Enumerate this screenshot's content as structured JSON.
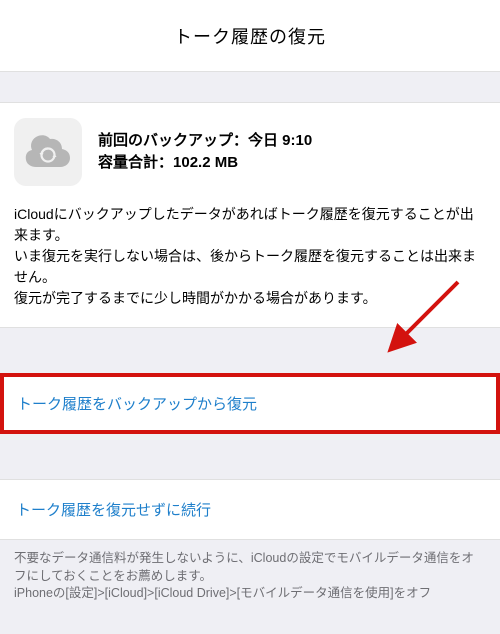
{
  "header": {
    "title": "トーク履歴の復元"
  },
  "backup": {
    "lastBackupLabel": "前回のバックアップ：",
    "lastBackupValue": "今日 9:10",
    "sizeLabel": "容量合計：",
    "sizeValue": "102.2 MB"
  },
  "description": {
    "line1": "iCloudにバックアップしたデータがあればトーク履歴を復元することが出来ます。",
    "line2": "いま復元を実行しない場合は、後からトーク履歴を復元することは出来ません。",
    "line3": "復元が完了するまでに少し時間がかかる場合があります。"
  },
  "actions": {
    "restore": "トーク履歴をバックアップから復元",
    "skip": "トーク履歴を復元せずに続行"
  },
  "footer": {
    "line1": "不要なデータ通信料が発生しないように、iCloudの設定でモバイルデータ通信をオフにしておくことをお薦めします。",
    "line2": "iPhoneの[設定]>[iCloud]>[iCloud Drive]>[モバイルデータ通信を使用]をオフ"
  },
  "icons": {
    "cloud": "cloud-refresh-icon"
  },
  "colors": {
    "link": "#1e7fcb",
    "highlight": "#d3120e"
  }
}
